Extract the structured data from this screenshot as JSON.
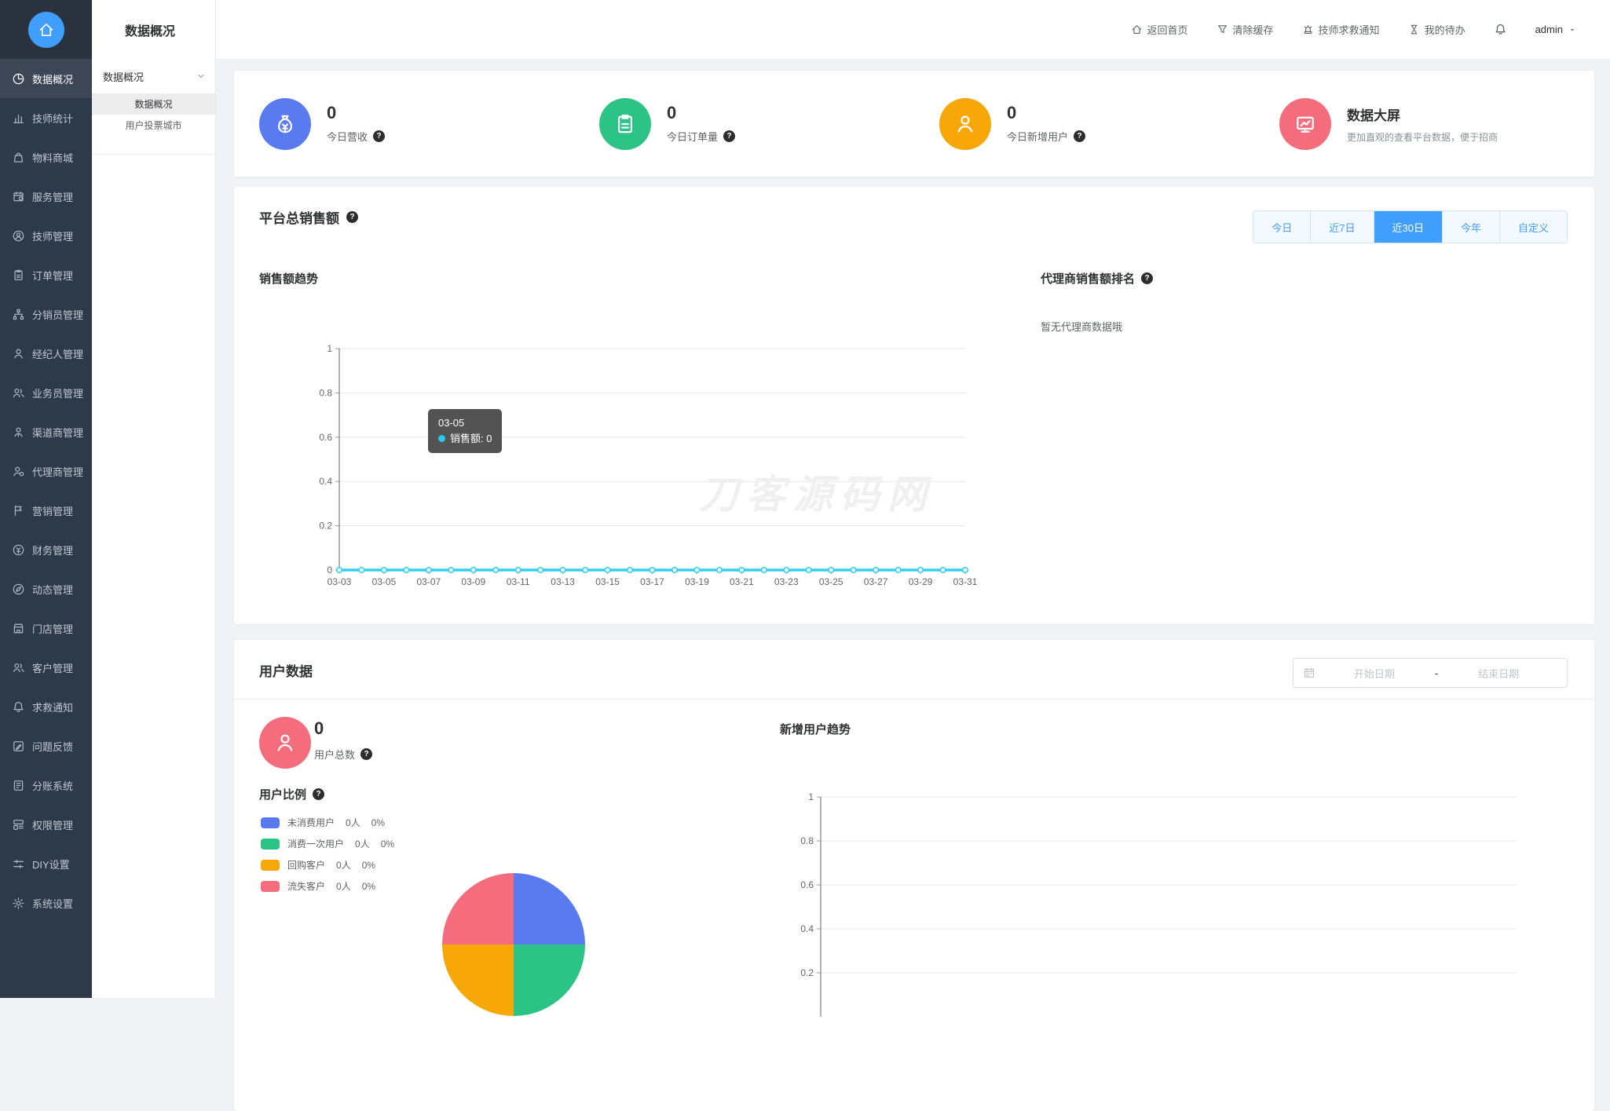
{
  "colors": {
    "accent": "#409eff",
    "sidebar_bg": "#2e3949",
    "line": "#35d0f0"
  },
  "sidebar": {
    "items": [
      {
        "key": "data-overview",
        "icon": "pie",
        "label": "数据概况",
        "active": true
      },
      {
        "key": "tech-stats",
        "icon": "bars",
        "label": "技师统计",
        "active": false
      },
      {
        "key": "material-mall",
        "icon": "bag",
        "label": "物料商城",
        "active": false
      },
      {
        "key": "service-mgmt",
        "icon": "service",
        "label": "服务管理",
        "active": false
      },
      {
        "key": "tech-mgmt",
        "icon": "person-circle",
        "label": "技师管理",
        "active": false
      },
      {
        "key": "order-mgmt",
        "icon": "clipboard",
        "label": "订单管理",
        "active": false
      },
      {
        "key": "distributor-mgmt",
        "icon": "org",
        "label": "分销员管理",
        "active": false
      },
      {
        "key": "broker-mgmt",
        "icon": "person",
        "label": "经纪人管理",
        "active": false
      },
      {
        "key": "salesman-mgmt",
        "icon": "people",
        "label": "业务员管理",
        "active": false
      },
      {
        "key": "channel-mgmt",
        "icon": "person-badge",
        "label": "渠道商管理",
        "active": false
      },
      {
        "key": "agent-mgmt",
        "icon": "person-gear",
        "label": "代理商管理",
        "active": false
      },
      {
        "key": "marketing-mgmt",
        "icon": "flag",
        "label": "营销管理",
        "active": false
      },
      {
        "key": "finance-mgmt",
        "icon": "coin",
        "label": "财务管理",
        "active": false
      },
      {
        "key": "dynamic-mgmt",
        "icon": "compass",
        "label": "动态管理",
        "active": false
      },
      {
        "key": "store-mgmt",
        "icon": "shop",
        "label": "门店管理",
        "active": false
      },
      {
        "key": "customer-mgmt",
        "icon": "people",
        "label": "客户管理",
        "active": false
      },
      {
        "key": "rescue-notice",
        "icon": "bell",
        "label": "求救通知",
        "active": false
      },
      {
        "key": "feedback",
        "icon": "edit-square",
        "label": "问题反馈",
        "active": false
      },
      {
        "key": "ledger-system",
        "icon": "ledger",
        "label": "分账系统",
        "active": false
      },
      {
        "key": "permission-mgmt",
        "icon": "layers",
        "label": "权限管理",
        "active": false
      },
      {
        "key": "diy-settings",
        "icon": "sliders",
        "label": "DIY设置",
        "active": false
      },
      {
        "key": "system-settings",
        "icon": "gear",
        "label": "系统设置",
        "active": false
      }
    ]
  },
  "submenu": {
    "title": "数据概况",
    "group_label": "数据概况",
    "items": [
      {
        "key": "data-overview",
        "label": "数据概况",
        "active": true
      },
      {
        "key": "user-vote-city",
        "label": "用户投票城市",
        "active": false
      }
    ]
  },
  "header": {
    "links": [
      {
        "key": "back-home",
        "icon": "home",
        "label": "返回首页"
      },
      {
        "key": "clear-cache",
        "icon": "funnel",
        "label": "清除缓存"
      },
      {
        "key": "tech-rescue-notice",
        "icon": "siren",
        "label": "技师求救通知"
      },
      {
        "key": "my-todo",
        "icon": "hourglass",
        "label": "我的待办"
      }
    ],
    "user": "admin"
  },
  "stats": {
    "cards": [
      {
        "key": "today-revenue",
        "icon": "money-bag",
        "color": "#5a7af0",
        "value": "0",
        "label": "今日营收"
      },
      {
        "key": "today-orders",
        "icon": "clipboard",
        "color": "#2cc387",
        "value": "0",
        "label": "今日订单量"
      },
      {
        "key": "today-new-users",
        "icon": "person",
        "color": "#f7a708",
        "value": "0",
        "label": "今日新增用户"
      }
    ],
    "screen_card": {
      "icon": "monitor",
      "color": "#f56d7d",
      "title": "数据大屏",
      "desc": "更加直观的查看平台数据，便于招商"
    }
  },
  "sales": {
    "title": "平台总销售额",
    "ranges": [
      {
        "label": "今日",
        "active": false
      },
      {
        "label": "近7日",
        "active": false
      },
      {
        "label": "近30日",
        "active": true
      },
      {
        "label": "今年",
        "active": false
      },
      {
        "label": "自定义",
        "active": false
      }
    ],
    "trend_title": "销售额趋势",
    "tooltip": {
      "date": "03-05",
      "text": "销售额: 0",
      "dot_color": "#29c8ea"
    },
    "rank": {
      "title": "代理商销售额排名",
      "empty": "暂无代理商数据哦"
    },
    "watermark": "刀客源码网"
  },
  "users": {
    "title": "用户数据",
    "date_picker": {
      "start_placeholder": "开始日期",
      "separator": "-",
      "end_placeholder": "结束日期"
    },
    "total": {
      "value": "0",
      "label": "用户总数"
    },
    "ratio_title": "用户比例",
    "legend": [
      {
        "label": "未消费用户",
        "count": "0人",
        "percent": "0%",
        "color": "#5a7af0"
      },
      {
        "label": "消费一次用户",
        "count": "0人",
        "percent": "0%",
        "color": "#2cc387"
      },
      {
        "label": "回购客户",
        "count": "0人",
        "percent": "0%",
        "color": "#f7a708"
      },
      {
        "label": "流失客户",
        "count": "0人",
        "percent": "0%",
        "color": "#f56d7d"
      }
    ],
    "trend_title": "新增用户趋势"
  },
  "chart_data": [
    {
      "id": "sales-trend",
      "type": "line",
      "title": "销售额趋势",
      "series": [
        {
          "name": "销售额",
          "values": [
            0,
            0,
            0,
            0,
            0,
            0,
            0,
            0,
            0,
            0,
            0,
            0,
            0,
            0,
            0,
            0,
            0,
            0,
            0,
            0,
            0,
            0,
            0,
            0,
            0,
            0,
            0,
            0,
            0
          ]
        }
      ],
      "x": [
        "03-03",
        "03-04",
        "03-05",
        "03-06",
        "03-07",
        "03-08",
        "03-09",
        "03-10",
        "03-11",
        "03-12",
        "03-13",
        "03-14",
        "03-15",
        "03-16",
        "03-17",
        "03-18",
        "03-19",
        "03-20",
        "03-21",
        "03-22",
        "03-23",
        "03-24",
        "03-25",
        "03-26",
        "03-27",
        "03-28",
        "03-29",
        "03-30",
        "03-31"
      ],
      "x_label_every": 2,
      "ylim": [
        0,
        1
      ],
      "yticks": [
        0,
        0.2,
        0.4,
        0.6,
        0.8,
        1
      ],
      "grid": true,
      "line_color": "#35d0f0",
      "tooltip_point": {
        "x": "03-05",
        "value": 0
      }
    },
    {
      "id": "new-user-trend",
      "type": "line",
      "title": "新增用户趋势",
      "series": [],
      "x": [],
      "ylim": [
        0,
        1
      ],
      "yticks": [
        0.2,
        0.4,
        0.6,
        0.8,
        1
      ],
      "grid": true
    },
    {
      "id": "user-ratio-pie",
      "type": "pie",
      "title": "用户比例",
      "categories": [
        "未消费用户",
        "消费一次用户",
        "回购客户",
        "流失客户"
      ],
      "values": [
        0,
        0,
        0,
        0
      ],
      "percents": [
        "0%",
        "0%",
        "0%",
        "0%"
      ],
      "slice_fractions": [
        0.25,
        0.25,
        0.25,
        0.25
      ],
      "colors": [
        "#5a7af0",
        "#2cc387",
        "#f7a708",
        "#f56d7d"
      ],
      "legend_position": "top-left"
    }
  ]
}
